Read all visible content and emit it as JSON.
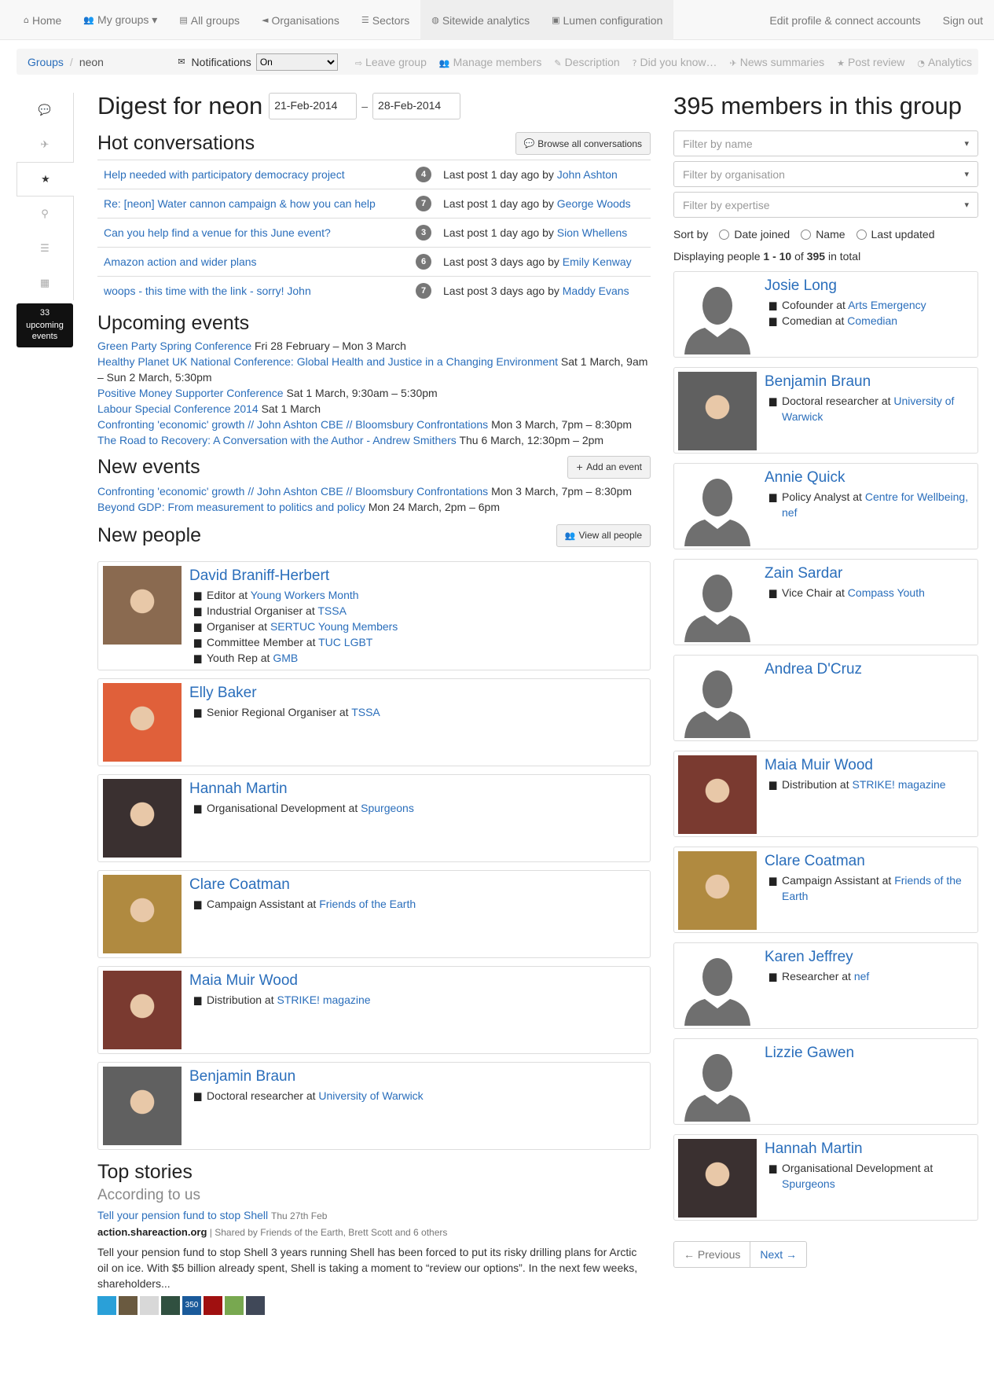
{
  "nav": {
    "left": [
      {
        "icon": "home-icon",
        "glyph": "⌂",
        "label": "Home"
      },
      {
        "icon": "users-icon",
        "glyph": "👥",
        "label": "My groups ▾"
      },
      {
        "icon": "book-icon",
        "glyph": "▤",
        "label": "All groups"
      },
      {
        "icon": "bullhorn-icon",
        "glyph": "◄",
        "label": "Organisations"
      },
      {
        "icon": "list-icon",
        "glyph": "☰",
        "label": "Sectors"
      },
      {
        "icon": "globe-icon",
        "glyph": "◍",
        "label": "Sitewide analytics"
      },
      {
        "icon": "briefcase-icon",
        "glyph": "▣",
        "label": "Lumen configuration"
      }
    ],
    "right": [
      {
        "label": "Edit profile & connect accounts"
      },
      {
        "label": "Sign out"
      }
    ]
  },
  "crumb": {
    "groups": "Groups",
    "sep": "/",
    "current": "neon"
  },
  "notifications": {
    "label": "Notifications",
    "value": "On"
  },
  "tools": [
    {
      "icon": "sign-out-icon",
      "glyph": "⇨",
      "label": "Leave group"
    },
    {
      "icon": "users-icon",
      "glyph": "👥",
      "label": "Manage members"
    },
    {
      "icon": "pencil-icon",
      "glyph": "✎",
      "label": "Description"
    },
    {
      "icon": "question-icon",
      "glyph": "?",
      "label": "Did you know…"
    },
    {
      "icon": "twitter-icon",
      "glyph": "✈",
      "label": "News summaries"
    },
    {
      "icon": "star-icon",
      "glyph": "★",
      "label": "Post review"
    },
    {
      "icon": "dashboard-icon",
      "glyph": "◔",
      "label": "Analytics"
    }
  ],
  "sidenav": [
    {
      "icon": "comments-icon",
      "glyph": "💬"
    },
    {
      "icon": "twitter-icon",
      "glyph": "✈"
    },
    {
      "icon": "star-icon",
      "glyph": "★"
    },
    {
      "icon": "map-marker-icon",
      "glyph": "⚲"
    },
    {
      "icon": "list-icon",
      "glyph": "☰"
    },
    {
      "icon": "calendar-icon",
      "glyph": "▦"
    }
  ],
  "events_badge": {
    "count": "33",
    "line1": "upcoming",
    "line2": "events"
  },
  "digest": {
    "title": "Digest for neon",
    "from": "21-Feb-2014",
    "dash": "–",
    "to": "28-Feb-2014"
  },
  "hot": {
    "title": "Hot conversations",
    "browse": "Browse all conversations",
    "rows": [
      {
        "title": "Help needed with participatory democracy project",
        "count": "4",
        "last": "Last post 1 day ago by",
        "by": "John Ashton"
      },
      {
        "title": "Re: [neon] Water cannon campaign & how you can help",
        "count": "7",
        "last": "Last post 1 day ago by",
        "by": "George Woods"
      },
      {
        "title": "Can you help find a venue for this June event?",
        "count": "3",
        "last": "Last post 1 day ago by",
        "by": "Sion Whellens"
      },
      {
        "title": "Amazon action and wider plans",
        "count": "6",
        "last": "Last post 3 days ago by",
        "by": "Emily Kenway"
      },
      {
        "title": "woops - this time with the link - sorry! John",
        "count": "7",
        "last": "Last post 3 days ago by",
        "by": "Maddy Evans"
      }
    ]
  },
  "upcoming": {
    "title": "Upcoming events",
    "items": [
      {
        "name": "Green Party Spring Conference",
        "when": "Fri 28 February – Mon 3 March"
      },
      {
        "name": "Healthy Planet UK National Conference: Global Health and Justice in a Changing Environment",
        "when": "Sat 1 March, 9am – Sun 2 March, 5:30pm"
      },
      {
        "name": "Positive Money Supporter Conference",
        "when": "Sat 1 March, 9:30am – 5:30pm"
      },
      {
        "name": "Labour Special Conference 2014",
        "when": "Sat 1 March"
      },
      {
        "name": "Confronting 'economic' growth // John Ashton CBE // Bloomsbury Confrontations",
        "when": "Mon 3 March, 7pm – 8:30pm"
      },
      {
        "name": "The Road to Recovery: A Conversation with the Author - Andrew Smithers",
        "when": "Thu 6 March, 12:30pm – 2pm"
      }
    ]
  },
  "newevents": {
    "title": "New events",
    "add": "Add an event",
    "items": [
      {
        "name": "Confronting 'economic' growth // John Ashton CBE // Bloomsbury Confrontations",
        "when": "Mon 3 March, 7pm – 8:30pm"
      },
      {
        "name": "Beyond GDP: From measurement to politics and policy",
        "when": "Mon 24 March, 2pm – 6pm"
      }
    ]
  },
  "newpeople": {
    "title": "New people",
    "viewall": "View all people",
    "people": [
      {
        "name": "David Braniff-Herbert",
        "photo": "#8a6a50",
        "roles": [
          {
            "role": "Editor at",
            "org": "Young Workers Month"
          },
          {
            "role": "Industrial Organiser at",
            "org": "TSSA"
          },
          {
            "role": "Organiser at",
            "org": "SERTUC Young Members"
          },
          {
            "role": "Committee Member at",
            "org": "TUC LGBT"
          },
          {
            "role": "Youth Rep at",
            "org": "GMB"
          }
        ]
      },
      {
        "name": "Elly Baker",
        "photo": "#e0603a",
        "roles": [
          {
            "role": "Senior Regional Organiser at",
            "org": "TSSA"
          }
        ]
      },
      {
        "name": "Hannah Martin",
        "photo": "#3a3030",
        "roles": [
          {
            "role": "Organisational Development at",
            "org": "Spurgeons"
          }
        ]
      },
      {
        "name": "Clare Coatman",
        "photo": "#b08a40",
        "roles": [
          {
            "role": "Campaign Assistant at",
            "org": "Friends of the Earth"
          }
        ]
      },
      {
        "name": "Maia Muir Wood",
        "photo": "#7a3a30",
        "roles": [
          {
            "role": "Distribution at",
            "org": "STRIKE! magazine"
          }
        ]
      },
      {
        "name": "Benjamin Braun",
        "photo": "#606060",
        "roles": [
          {
            "role": "Doctoral researcher at",
            "org": "University of Warwick"
          }
        ]
      }
    ]
  },
  "stories": {
    "title": "Top stories",
    "subtitle": "According to us",
    "headline": "Tell your pension fund to stop Shell",
    "date": "Thu 27th Feb",
    "site": "action.shareaction.org",
    "shared": "| Shared by Friends of the Earth, Brett Scott and 6 others",
    "body": "Tell your pension fund to stop Shell 3 years running Shell has been forced to put its risky drilling plans for Arctic oil on ice. With $5 billion already spent, Shell is taking a moment to “review our options”. In the next few weeks, shareholders...",
    "sharers": [
      {
        "color": "#2aa0d8",
        "label": ""
      },
      {
        "color": "#6a5a40",
        "label": ""
      },
      {
        "color": "#d8d8d8",
        "label": ""
      },
      {
        "color": "#305040",
        "label": ""
      },
      {
        "color": "#1a5a9a",
        "label": "350"
      },
      {
        "color": "#a01010",
        "label": ""
      },
      {
        "color": "#78a850",
        "label": ""
      },
      {
        "color": "#404858",
        "label": ""
      }
    ]
  },
  "members": {
    "title": "395 members in this group",
    "filters": [
      "Filter by name",
      "Filter by organisation",
      "Filter by expertise"
    ],
    "sortby": "Sort by",
    "sorts": [
      "Date joined",
      "Name",
      "Last updated"
    ],
    "displaying_a": "Displaying people",
    "range": "1 - 10",
    "of": "of",
    "total": "395",
    "in_total": "in total",
    "list": [
      {
        "name": "Josie Long",
        "photo": "",
        "roles": [
          {
            "role": "Cofounder at",
            "org": "Arts Emergency"
          },
          {
            "role": "Comedian at",
            "org": "Comedian"
          }
        ]
      },
      {
        "name": "Benjamin Braun",
        "photo": "#606060",
        "roles": [
          {
            "role": "Doctoral researcher at",
            "org": "University of Warwick"
          }
        ]
      },
      {
        "name": "Annie Quick",
        "photo": "",
        "roles": [
          {
            "role": "Policy Analyst at",
            "org": "Centre for Wellbeing, nef"
          }
        ]
      },
      {
        "name": "Zain Sardar",
        "photo": "",
        "roles": [
          {
            "role": "Vice Chair at",
            "org": "Compass Youth"
          }
        ]
      },
      {
        "name": "Andrea D'Cruz",
        "photo": "",
        "roles": []
      },
      {
        "name": "Maia Muir Wood",
        "photo": "#7a3a30",
        "roles": [
          {
            "role": "Distribution at",
            "org": "STRIKE! magazine"
          }
        ]
      },
      {
        "name": "Clare Coatman",
        "photo": "#b08a40",
        "roles": [
          {
            "role": "Campaign Assistant at",
            "org": "Friends of the Earth"
          }
        ]
      },
      {
        "name": "Karen Jeffrey",
        "photo": "",
        "roles": [
          {
            "role": "Researcher at",
            "org": "nef"
          }
        ]
      },
      {
        "name": "Lizzie Gawen",
        "photo": "",
        "roles": []
      },
      {
        "name": "Hannah Martin",
        "photo": "#3a3030",
        "roles": [
          {
            "role": "Organisational Development at",
            "org": "Spurgeons"
          }
        ]
      }
    ],
    "prev": "← Previous",
    "next": "Next →"
  }
}
